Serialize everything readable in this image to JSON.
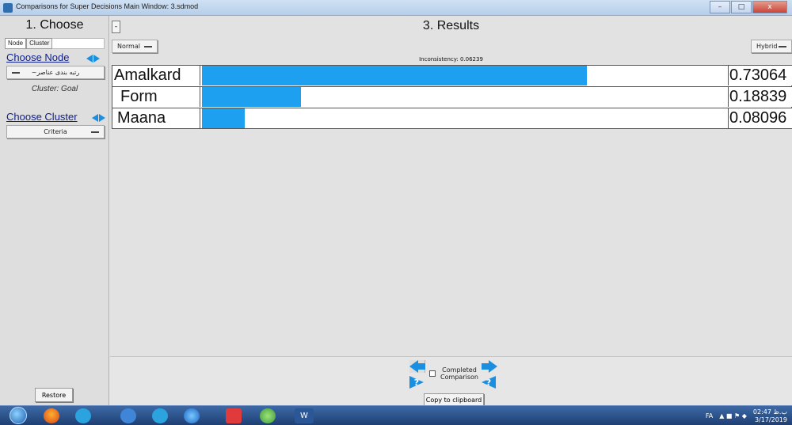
{
  "window": {
    "title": "Comparisons for Super Decisions Main Window: 3.sdmod",
    "min_symbol": "–",
    "max_symbol": "□",
    "close_symbol": "x"
  },
  "left_panel": {
    "heading": "1. Choose",
    "tabs": [
      {
        "label": "Node"
      },
      {
        "label": "Cluster"
      }
    ],
    "choose_node_label": "Choose Node",
    "node_dropdown_value": "~رتبه بندی عناصر",
    "cluster_caption": "Cluster: Goal",
    "choose_cluster_label": "Choose Cluster",
    "cluster_dropdown_value": "Criteria",
    "restore_label": "Restore"
  },
  "main": {
    "collapse_symbol": "-",
    "title": "3. Results",
    "left_mode": "Normal",
    "right_mode": "Hybrid",
    "inconsistency": "Inconsistency: 0.06239",
    "results": [
      {
        "name": "Amalkard",
        "value": "0.73064",
        "fraction": 0.73064
      },
      {
        "name": "Form",
        "value": "0.18839",
        "fraction": 0.18839
      },
      {
        "name": "Maana",
        "value": "0.08096",
        "fraction": 0.08096
      }
    ],
    "bar_color": "#1ea0f0",
    "completed_line1": "Completed",
    "completed_line2": "Comparison",
    "help_symbol": "?",
    "copy_label": "Copy to clipboard"
  },
  "taskbar": {
    "language": "FA",
    "time": "02:47 ب.ظ",
    "date": "3/17/2019",
    "word_label": "W"
  }
}
